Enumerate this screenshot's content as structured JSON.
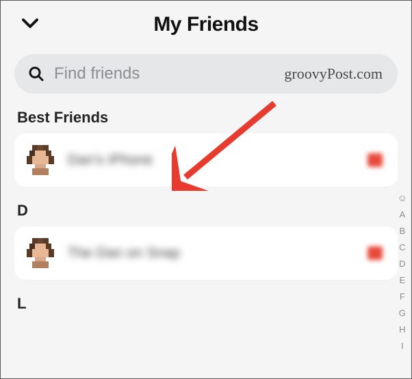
{
  "header": {
    "title": "My Friends"
  },
  "search": {
    "placeholder": "Find friends"
  },
  "watermark": "groovyPost.com",
  "sections": [
    {
      "label": "Best Friends"
    },
    {
      "label": "D"
    },
    {
      "label": "L"
    }
  ],
  "friends": {
    "best": [
      {
        "name": "Dan's iPhone"
      }
    ],
    "d": [
      {
        "name": "The Dan on Snap"
      }
    ]
  },
  "index_rail": [
    "A",
    "B",
    "C",
    "D",
    "E",
    "F",
    "G",
    "H",
    "I"
  ]
}
